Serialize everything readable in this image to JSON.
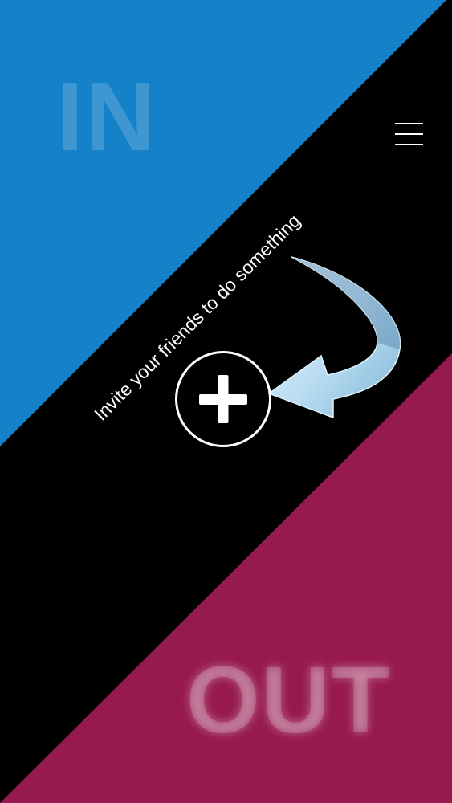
{
  "colors": {
    "in_panel": "#1581c8",
    "out_panel": "#96194f",
    "middle_band": "#000000",
    "foreground": "#ffffff"
  },
  "panels": {
    "in_label": "IN",
    "out_label": "OUT"
  },
  "header": {
    "menu_icon": "hamburger-menu-icon"
  },
  "main": {
    "invite_text": "Invite your friends to do something",
    "add_button_icon": "plus-icon",
    "hint_arrow_icon": "curved-arrow-icon"
  }
}
